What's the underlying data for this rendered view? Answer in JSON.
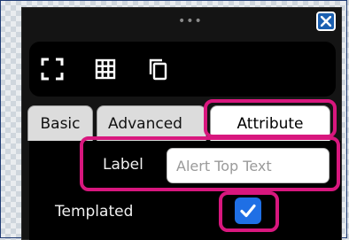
{
  "header": {
    "drag_handle": "•••",
    "close_icon": "close-icon"
  },
  "toolbar": {
    "icons": [
      "fullscreen-icon",
      "grid-icon",
      "copy-icon"
    ]
  },
  "tabs": [
    {
      "label": "Basic",
      "active": false
    },
    {
      "label": "Advanced",
      "active": false
    },
    {
      "label": "Attribute",
      "active": true
    }
  ],
  "form": {
    "label_caption": "Label",
    "label_value": "",
    "label_placeholder": "Alert Top Text",
    "templated_caption": "Templated",
    "templated_checked": true
  },
  "colors": {
    "highlight": "#d8177e",
    "checkbox": "#1f6fe5",
    "close_button": "#1b5fb0"
  }
}
